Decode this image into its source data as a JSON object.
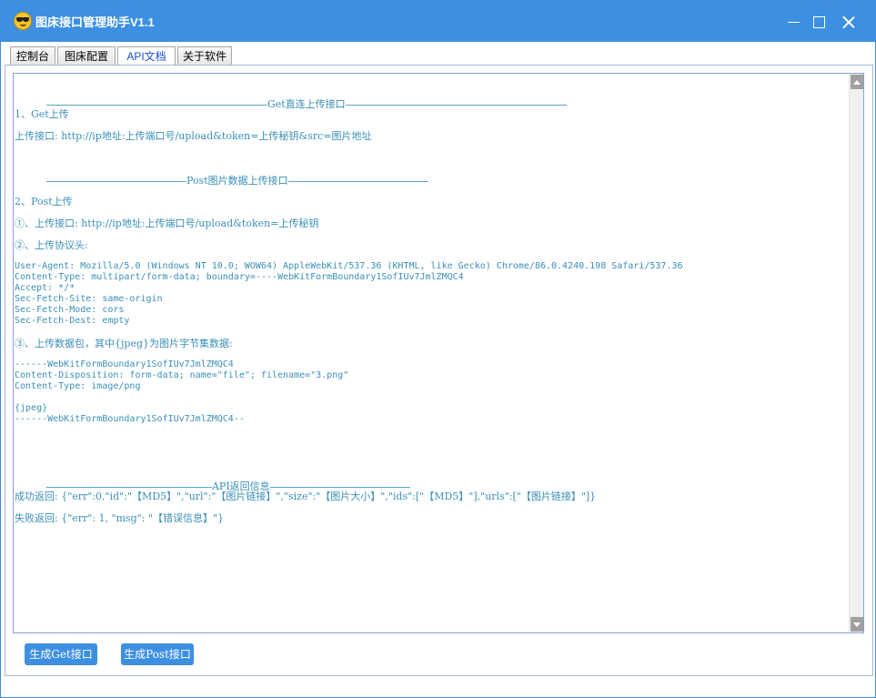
{
  "window": {
    "title": "图床接口管理助手V1.1"
  },
  "tabs": [
    {
      "label": "控制台"
    },
    {
      "label": "图床配置"
    },
    {
      "label": "API文档"
    },
    {
      "label": "关于软件"
    }
  ],
  "doc": {
    "section_get": "Get直连上传接口",
    "get_item": "1、Get上传",
    "get_url": "上传接口: http://ip地址:上传端口号/upload&token=上传秘钥&src=图片地址",
    "section_post": "Post图片数据上传接口",
    "post_item": "2、Post上传",
    "post_step1": "①、上传接口: http://ip地址:上传端口号/upload&token=上传秘钥",
    "post_step2": "②、上传协议头:",
    "headers": [
      "User-Agent: Mozilla/5.0 (Windows NT 10.0; WOW64) AppleWebKit/537.36 (KHTML, like Gecko) Chrome/86.0.4240.198 Safari/537.36",
      "Content-Type: multipart/form-data; boundary=----WebKitFormBoundary1SofIUv7JmlZMQC4",
      "Accept: */*",
      "Sec-Fetch-Site: same-origin",
      "Sec-Fetch-Mode: cors",
      "Sec-Fetch-Dest: empty"
    ],
    "post_step3": "③、上传数据包，其中{jpeg}为图片字节集数据:",
    "body_lines": [
      "------WebKitFormBoundary1SofIUv7JmlZMQC4",
      "Content-Disposition: form-data; name=\"file\"; filename=\"3.png\"",
      "Content-Type: image/png",
      "",
      "{jpeg}",
      "------WebKitFormBoundary1SofIUv7JmlZMQC4--"
    ],
    "section_api": "API返回信息",
    "success": "成功返回: {\"err\":0,\"id\":\"【MD5】\",\"url\":\"【图片链接】\",\"size\":\"【图片大小】\",\"ids\":[\"【MD5】\"],\"urls\":[\"【图片链接】\"]}",
    "fail": "失败返回: {\"err\": 1, \"msg\": \"【错误信息】\"}"
  },
  "buttons": {
    "gen_get": "生成Get接口",
    "gen_post": "生成Post接口"
  },
  "colors": {
    "titlebar": "#3d8fe2",
    "doc_text": "#3a8fb7",
    "active_tab_text": "#1a4fd0"
  }
}
